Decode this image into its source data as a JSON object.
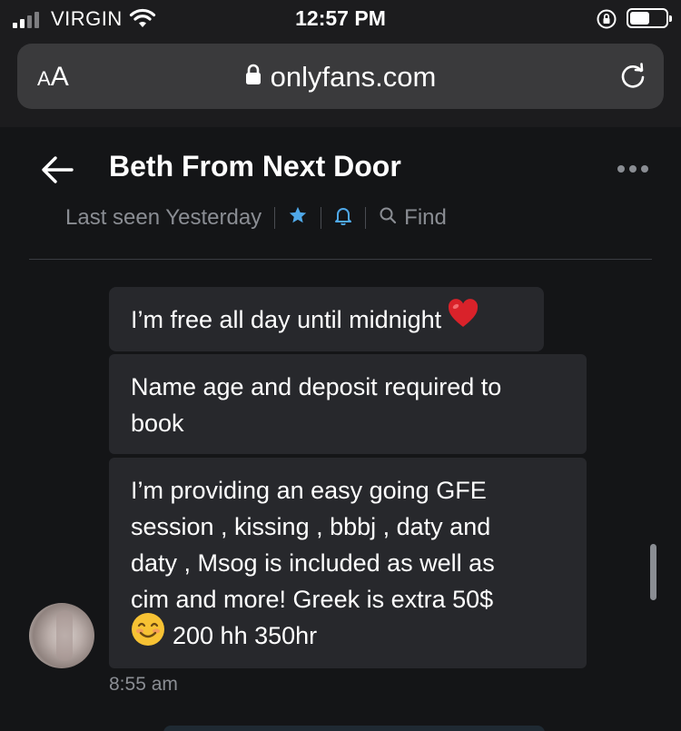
{
  "status_bar": {
    "carrier": "VIRGIN",
    "time": "12:57 PM",
    "battery_level": 0.55
  },
  "browser": {
    "text_size_label_small": "A",
    "text_size_label_large": "A",
    "url": "onlyfans.com"
  },
  "chat": {
    "title": "Beth From Next Door",
    "last_seen": "Last seen Yesterday",
    "find_label": "Find",
    "colors": {
      "accent": "#4fa8e8",
      "bubble": "#27282c",
      "background": "#141517",
      "muted": "#8a8d93"
    }
  },
  "messages": [
    {
      "text": "I’m free all day until midnight"
    },
    {
      "text_line1": "Name age and deposit required to",
      "text_line2": "book"
    },
    {
      "line1": "I’m providing an easy going GFE",
      "line2": "session , kissing , bbbj , daty and",
      "line3": "daty , Msog is included as well as",
      "line4": "cim and more! Greek is extra 50$",
      "line5": "200 hh 350hr"
    }
  ],
  "message_time": "8:55 am",
  "icons": [
    "signal-icon",
    "wifi-icon",
    "rotation-lock-icon",
    "battery-icon",
    "padlock-icon",
    "reload-icon",
    "back-arrow-icon",
    "more-options-icon",
    "star-icon",
    "bell-icon",
    "search-icon",
    "heart-emoji",
    "smile-emoji"
  ]
}
